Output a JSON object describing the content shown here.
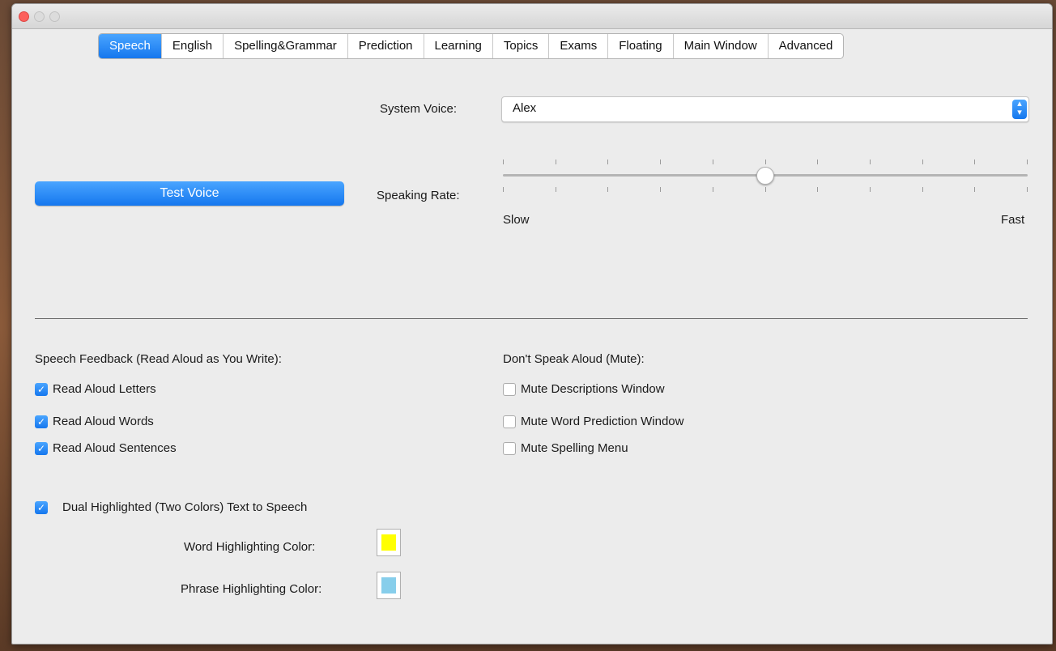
{
  "tabs": [
    {
      "label": "Speech",
      "active": true
    },
    {
      "label": "English",
      "active": false
    },
    {
      "label": "Spelling&Grammar",
      "active": false
    },
    {
      "label": "Prediction",
      "active": false
    },
    {
      "label": "Learning",
      "active": false
    },
    {
      "label": "Topics",
      "active": false
    },
    {
      "label": "Exams",
      "active": false
    },
    {
      "label": "Floating",
      "active": false
    },
    {
      "label": "Main Window",
      "active": false
    },
    {
      "label": "Advanced",
      "active": false
    }
  ],
  "voice": {
    "label": "System Voice:",
    "selected": "Alex",
    "test_button": "Test Voice"
  },
  "rate": {
    "label": "Speaking Rate:",
    "min_label": "Slow",
    "max_label": "Fast",
    "tick_count": 11,
    "value_fraction": 0.5
  },
  "feedback": {
    "heading": "Speech Feedback (Read Aloud as You Write):",
    "items": [
      {
        "label": "Read Aloud Letters",
        "checked": true
      },
      {
        "label": "Read Aloud Words",
        "checked": true
      },
      {
        "label": "Read Aloud Sentences",
        "checked": true
      }
    ]
  },
  "mute": {
    "heading": "Don't Speak Aloud (Mute):",
    "items": [
      {
        "label": "Mute Descriptions Window",
        "checked": false
      },
      {
        "label": "Mute Word Prediction Window",
        "checked": false
      },
      {
        "label": "Mute Spelling Menu",
        "checked": false
      }
    ]
  },
  "dual": {
    "label": "Dual Highlighted (Two Colors) Text to Speech",
    "checked": true,
    "word_label": "Word Highlighting Color:",
    "phrase_label": "Phrase Highlighting Color:"
  },
  "colors": {
    "accent": "#1a7ff0",
    "word_highlight": "#ffff00",
    "phrase_highlight": "#87ceeb"
  },
  "icons": {
    "check": "checkmark-icon",
    "select_arrows": "up-down-chevron-icon"
  }
}
